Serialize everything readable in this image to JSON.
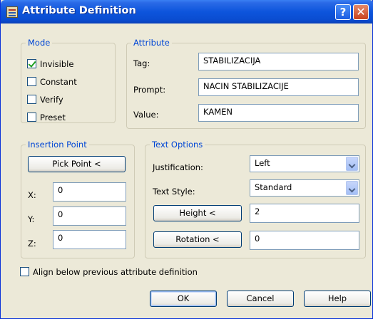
{
  "window": {
    "title": "Attribute Definition",
    "help_glyph": "?",
    "close_glyph": "✕"
  },
  "mode": {
    "legend": "Mode",
    "invisible": {
      "label": "Invisible",
      "checked": true
    },
    "constant": {
      "label": "Constant",
      "checked": false
    },
    "verify": {
      "label": "Verify",
      "checked": false
    },
    "preset": {
      "label": "Preset",
      "checked": false
    }
  },
  "attribute": {
    "legend": "Attribute",
    "tag_label": "Tag:",
    "tag_value": "STABILIZACIJA",
    "prompt_label": "Prompt:",
    "prompt_value": "NACIN STABILIZACIJE",
    "value_label": "Value:",
    "value_value": "KAMEN"
  },
  "insertion": {
    "legend": "Insertion Point",
    "pick_point_label": "Pick Point <",
    "x_label": "X:",
    "x_value": "0",
    "y_label": "Y:",
    "y_value": "0",
    "z_label": "Z:",
    "z_value": "0"
  },
  "text_options": {
    "legend": "Text Options",
    "justification_label": "Justification:",
    "justification_value": "Left",
    "text_style_label": "Text Style:",
    "text_style_value": "Standard",
    "height_button": "Height <",
    "height_value": "2",
    "rotation_button": "Rotation <",
    "rotation_value": "0"
  },
  "align_below": {
    "label": "Align below previous attribute definition",
    "checked": false
  },
  "buttons": {
    "ok": "OK",
    "cancel": "Cancel",
    "help": "Help"
  },
  "colors": {
    "titlebar": "#0a4cd0",
    "dialog_bg": "#ece9d8",
    "legend_text": "#0046d5",
    "checkmark": "#21a121"
  }
}
